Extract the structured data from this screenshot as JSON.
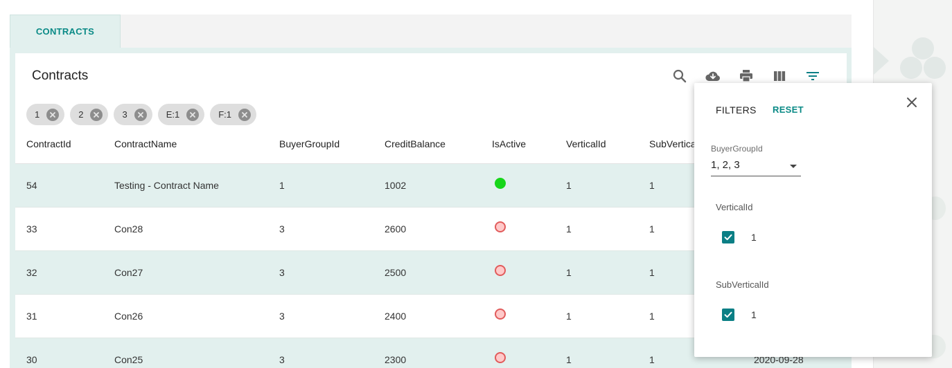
{
  "tabs": [
    {
      "label": "CONTRACTS"
    }
  ],
  "card": {
    "title": "Contracts"
  },
  "toolbar": {
    "icons": [
      "search-icon",
      "cloud-download-icon",
      "print-icon",
      "view-column-icon",
      "filter-list-icon"
    ]
  },
  "chips": [
    {
      "label": "1"
    },
    {
      "label": "2"
    },
    {
      "label": "3"
    },
    {
      "label": "E:1"
    },
    {
      "label": "F:1"
    }
  ],
  "table": {
    "columns": [
      "ContractId",
      "ContractName",
      "BuyerGroupId",
      "CreditBalance",
      "IsActive",
      "VerticalId",
      "SubVertica"
    ],
    "rows": [
      {
        "id": "54",
        "name": "Testing - Contract Name",
        "buyer": "1",
        "credit": "1002",
        "active": true,
        "vertical": "1",
        "sub": "1",
        "extra": ""
      },
      {
        "id": "33",
        "name": "Con28",
        "buyer": "3",
        "credit": "2600",
        "active": false,
        "vertical": "1",
        "sub": "1",
        "extra": ""
      },
      {
        "id": "32",
        "name": "Con27",
        "buyer": "3",
        "credit": "2500",
        "active": false,
        "vertical": "1",
        "sub": "1",
        "extra": ""
      },
      {
        "id": "31",
        "name": "Con26",
        "buyer": "3",
        "credit": "2400",
        "active": false,
        "vertical": "1",
        "sub": "1",
        "extra": ""
      },
      {
        "id": "30",
        "name": "Con25",
        "buyer": "3",
        "credit": "2300",
        "active": false,
        "vertical": "1",
        "sub": "1",
        "extra": "2020-09-28"
      }
    ]
  },
  "filters": {
    "title": "FILTERS",
    "reset": "RESET",
    "buyer_group": {
      "label": "BuyerGroupId",
      "value": "1, 2, 3"
    },
    "groups": [
      {
        "label": "VerticalId",
        "option": "1",
        "checked": true
      },
      {
        "label": "SubVerticalId",
        "option": "1",
        "checked": true
      }
    ]
  },
  "colors": {
    "accent": "#0a8a86",
    "row_alt": "#e2f0ee",
    "active": "#17d61a",
    "inactive": "#e15b5b"
  }
}
